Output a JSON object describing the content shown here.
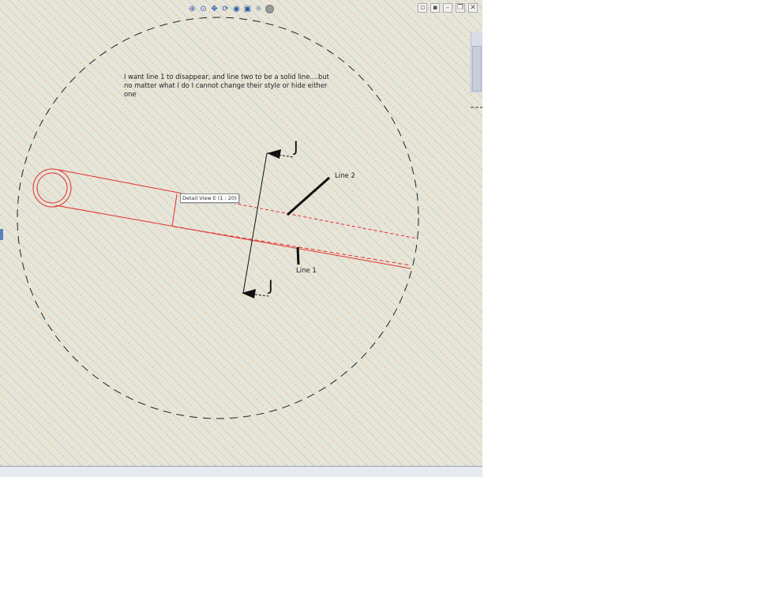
{
  "note": {
    "line1": "I want line 1 to disappear, and line two to be a solid line....but",
    "line2": "no matter what I do I cannot change their style or hide either",
    "line3": "one"
  },
  "labels": {
    "line2": "Line 2",
    "line1": "Line 1"
  },
  "section_marker": {
    "top": "J",
    "bottom": "J"
  },
  "tooltip": "Detail View E (1 : 20)",
  "toolbar": {
    "icons": [
      "zoom-in-icon",
      "zoom-region-icon",
      "pan-icon",
      "rotate-icon",
      "render-icon",
      "view-cube-icon",
      "visibility-icon",
      "sun-icon"
    ]
  },
  "window_controls": {
    "icons": [
      "tile-icon",
      "cascade-icon",
      "minimize-icon",
      "restore-icon",
      "close-icon"
    ]
  },
  "colors": {
    "background": "#e6e5da",
    "hatch": "#f0a75a",
    "hatch_alt": "#c9c9b8",
    "detail_red": "#e0302e",
    "ink": "#111111"
  }
}
